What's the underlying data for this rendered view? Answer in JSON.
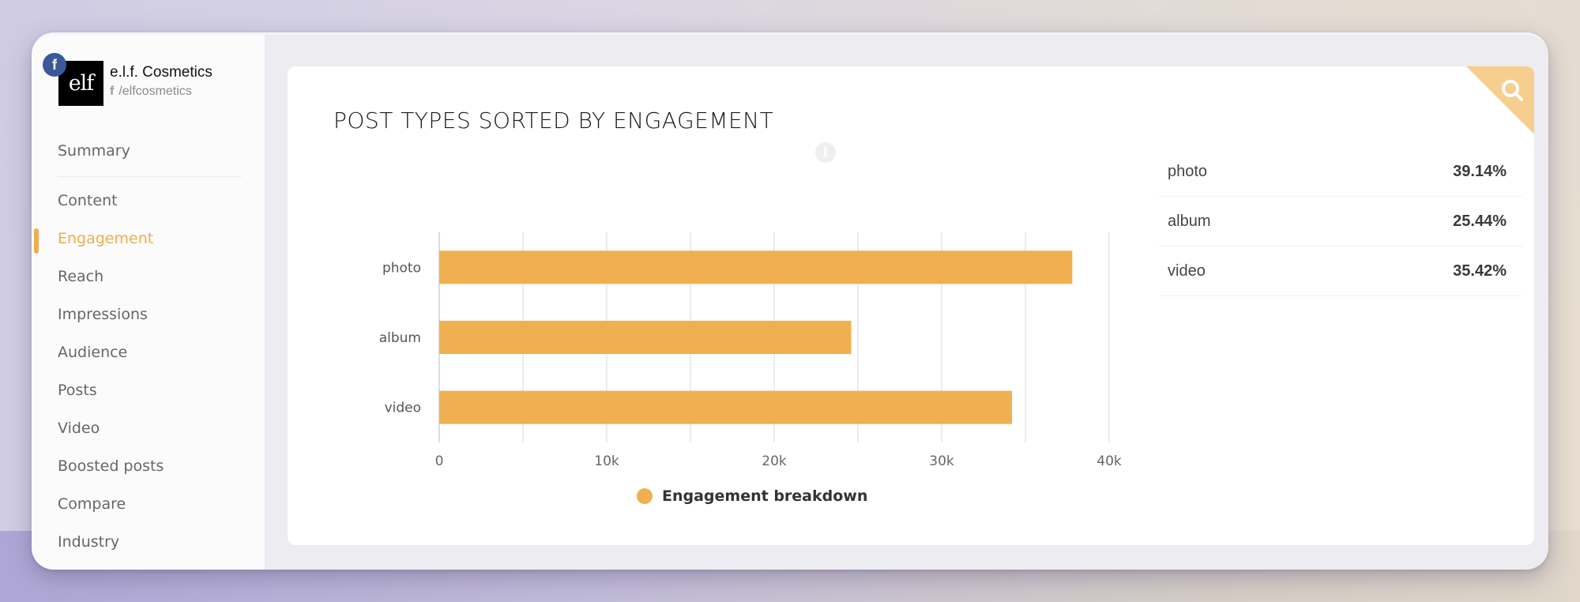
{
  "brand": {
    "name": "e.l.f. Cosmetics",
    "handle": "/elfcosmetics",
    "logo_text": "elf",
    "network_badge": "f",
    "network_icon": "facebook-icon"
  },
  "sidebar": {
    "items": [
      {
        "label": "Summary",
        "active": false
      },
      {
        "label": "Content",
        "active": false
      },
      {
        "label": "Engagement",
        "active": true
      },
      {
        "label": "Reach",
        "active": false
      },
      {
        "label": "Impressions",
        "active": false
      },
      {
        "label": "Audience",
        "active": false
      },
      {
        "label": "Posts",
        "active": false
      },
      {
        "label": "Video",
        "active": false
      },
      {
        "label": "Boosted posts",
        "active": false
      },
      {
        "label": "Compare",
        "active": false
      },
      {
        "label": "Industry",
        "active": false
      }
    ]
  },
  "card": {
    "title": "POST TYPES SORTED BY ENGAGEMENT",
    "info_icon": "i",
    "corner_icon": "search-icon"
  },
  "colors": {
    "accent": "#f0ad4e",
    "bar": "#f0b050",
    "corner": "#f6cf8e",
    "facebook": "#3b5998"
  },
  "chart_data": {
    "type": "bar",
    "orientation": "horizontal",
    "title": "POST TYPES SORTED BY ENGAGEMENT",
    "categories": [
      "photo",
      "album",
      "video"
    ],
    "series": [
      {
        "name": "Engagement breakdown",
        "values": [
          37800,
          24600,
          34200
        ]
      }
    ],
    "xlabel": "",
    "ylabel": "",
    "xlim": [
      0,
      40000
    ],
    "xticks": [
      0,
      10000,
      20000,
      30000,
      40000
    ],
    "xtick_labels": [
      "0",
      "10k",
      "20k",
      "30k",
      "40k"
    ],
    "minor_gridlines": [
      5000,
      15000,
      25000,
      35000
    ],
    "grid": true,
    "legend": "bottom-center"
  },
  "legend": {
    "label": "Engagement breakdown"
  },
  "stats": [
    {
      "label": "photo",
      "value": "39.14%"
    },
    {
      "label": "album",
      "value": "25.44%"
    },
    {
      "label": "video",
      "value": "35.42%"
    }
  ]
}
